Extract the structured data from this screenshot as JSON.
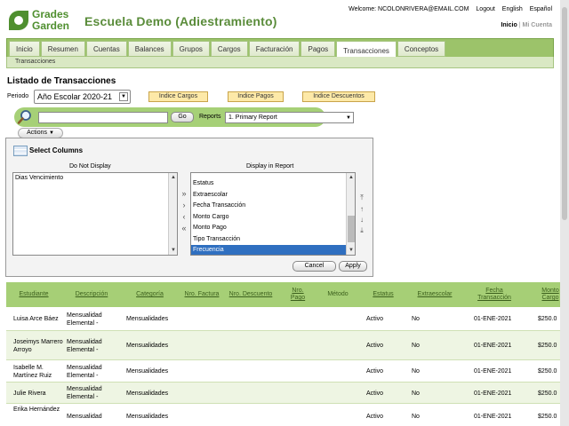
{
  "header": {
    "logo_text": [
      "Grades",
      "Garden"
    ],
    "school_name": "Escuela Demo (Adiestramiento)",
    "welcome_text": "Welcome: NCOLONRIVERA@EMAIL.COM",
    "logout": "Logout",
    "english": "English",
    "espanol": "Español",
    "inicio": "Inicio",
    "separator": "|",
    "mi_cuenta": "Mi Cuenta"
  },
  "nav": {
    "tabs": [
      "Inicio",
      "Resumen",
      "Cuentas",
      "Balances",
      "Grupos",
      "Cargos",
      "Facturación",
      "Pagos",
      "Transacciones",
      "Conceptos"
    ],
    "active": "Transacciones",
    "subnav": "Transacciones"
  },
  "page": {
    "title": "Listado de Transacciones",
    "periodo_label": "Periodo",
    "periodo_value": "Año Escolar 2020-21",
    "buttons": [
      "Indice Cargos",
      "Indice Pagos",
      "Indice Descuentos"
    ]
  },
  "search": {
    "go": "Go",
    "reports_label": "Reports",
    "report_value": "1. Primary Report",
    "actions": "Actions"
  },
  "columns_panel": {
    "title": "Select Columns",
    "do_not_display_label": "Do Not Display",
    "display_label": "Display in Report",
    "do_not_display": [
      "Dias Vencimiento"
    ],
    "display": [
      "Estatus",
      "Extraescolar",
      "Fecha Transacción",
      "Monto Cargo",
      "Monto Pago",
      "Tipo Transacción",
      "Frecuencia"
    ],
    "selected": "Frecuencia",
    "cancel": "Cancel",
    "apply": "Apply"
  },
  "table": {
    "headers": [
      "Estudiante",
      "Descripción",
      "Categoría",
      "Nro. Factura",
      "Nro. Descuento",
      "Nro. Pago",
      "Método",
      "Estatus",
      "Extraescolar",
      "Fecha Transacción",
      "Monto Cargo"
    ],
    "rows": [
      [
        "Luisa Arce Báez",
        "Mensualidad Elemental -",
        "Mensualidades",
        "",
        "",
        "",
        "",
        "Activo",
        "No",
        "01-ENE-2021",
        "$250.0"
      ],
      [
        "Joseimys Marrero Arroyo",
        "Mensualidad Elemental -",
        "Mensualidades",
        "",
        "",
        "",
        "",
        "Activo",
        "No",
        "01-ENE-2021",
        "$250.0"
      ],
      [
        "Isabelle M. Martínez Ruiz",
        "Mensualidad Elemental -",
        "Mensualidades",
        "",
        "",
        "",
        "",
        "Activo",
        "No",
        "01-ENE-2021",
        "$250.0"
      ],
      [
        "Julie Rivera",
        "Mensualidad Elemental -",
        "Mensualidades",
        "",
        "",
        "",
        "",
        "Activo",
        "No",
        "01-ENE-2021",
        "$250.0"
      ],
      [
        "Erika Hernández",
        "Mensualidad",
        "Mensualidades",
        "",
        "",
        "",
        "",
        "Activo",
        "No",
        "01-ENE-2021",
        "$250.0"
      ]
    ]
  }
}
